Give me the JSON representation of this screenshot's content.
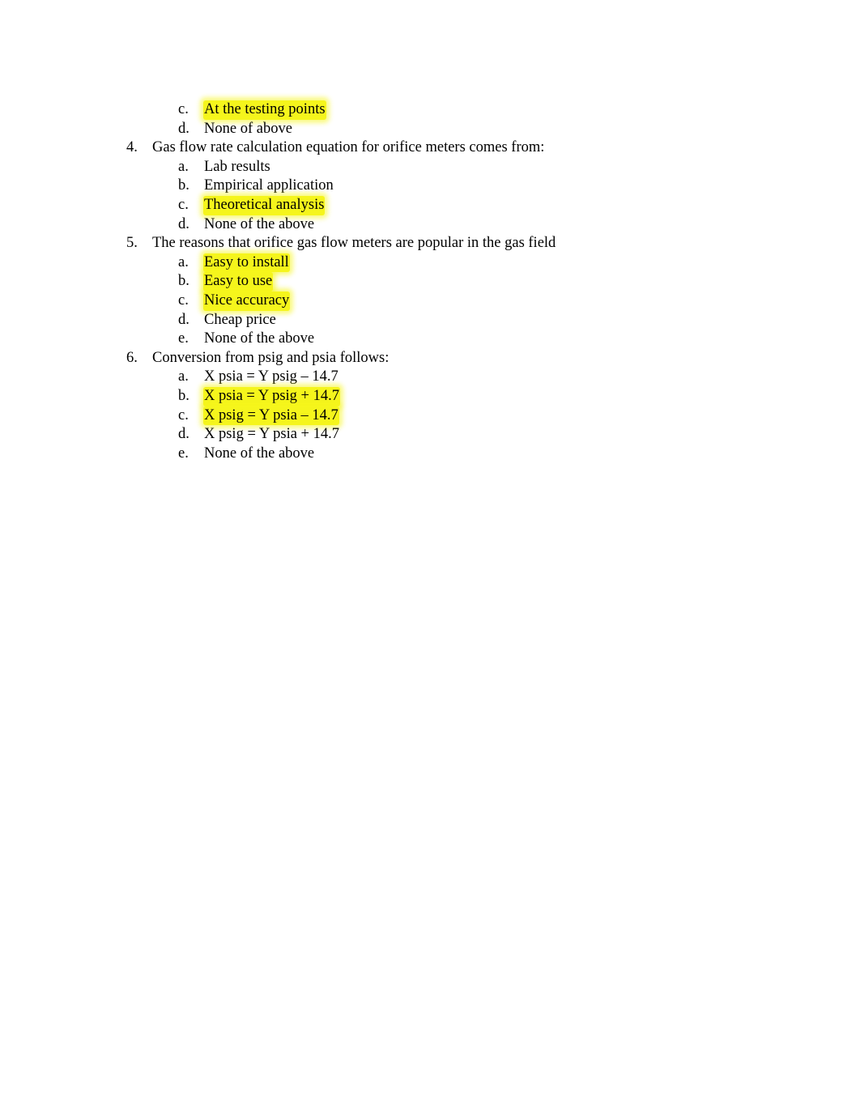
{
  "document": {
    "highlight_color": "#f5f51c",
    "continued_options": [
      {
        "letter": "c.",
        "text": "At the testing points",
        "highlighted": true
      },
      {
        "letter": "d.",
        "text": "None of above",
        "highlighted": false
      }
    ],
    "questions": [
      {
        "number": "4.",
        "text": "Gas flow rate calculation equation for orifice meters comes from:",
        "options": [
          {
            "letter": "a.",
            "text": "Lab results",
            "highlighted": false
          },
          {
            "letter": "b.",
            "text": "Empirical application",
            "highlighted": false
          },
          {
            "letter": "c.",
            "text": "Theoretical analysis",
            "highlighted": true
          },
          {
            "letter": "d.",
            "text": "None of the above",
            "highlighted": false
          }
        ]
      },
      {
        "number": "5.",
        "text": "The reasons that orifice gas flow meters are popular in the gas field",
        "options": [
          {
            "letter": "a.",
            "text": "Easy to install",
            "highlighted": true
          },
          {
            "letter": "b.",
            "text": "Easy to use",
            "highlighted": true
          },
          {
            "letter": "c.",
            "text": "Nice accuracy",
            "highlighted": true
          },
          {
            "letter": "d.",
            "text": "Cheap price",
            "highlighted": false
          },
          {
            "letter": "e.",
            "text": "None of the above",
            "highlighted": false
          }
        ]
      },
      {
        "number": "6.",
        "text": "Conversion from psig and psia follows:",
        "options": [
          {
            "letter": "a.",
            "text": "X psia = Y psig – 14.7",
            "highlighted": false
          },
          {
            "letter": "b.",
            "text": "X psia = Y psig + 14.7",
            "highlighted": true
          },
          {
            "letter": "c.",
            "text": "X psig = Y psia – 14.7",
            "highlighted": true
          },
          {
            "letter": "d.",
            "text": "X psig = Y psia + 14.7",
            "highlighted": false
          },
          {
            "letter": "e.",
            "text": "None of the above",
            "highlighted": false
          }
        ]
      }
    ]
  }
}
